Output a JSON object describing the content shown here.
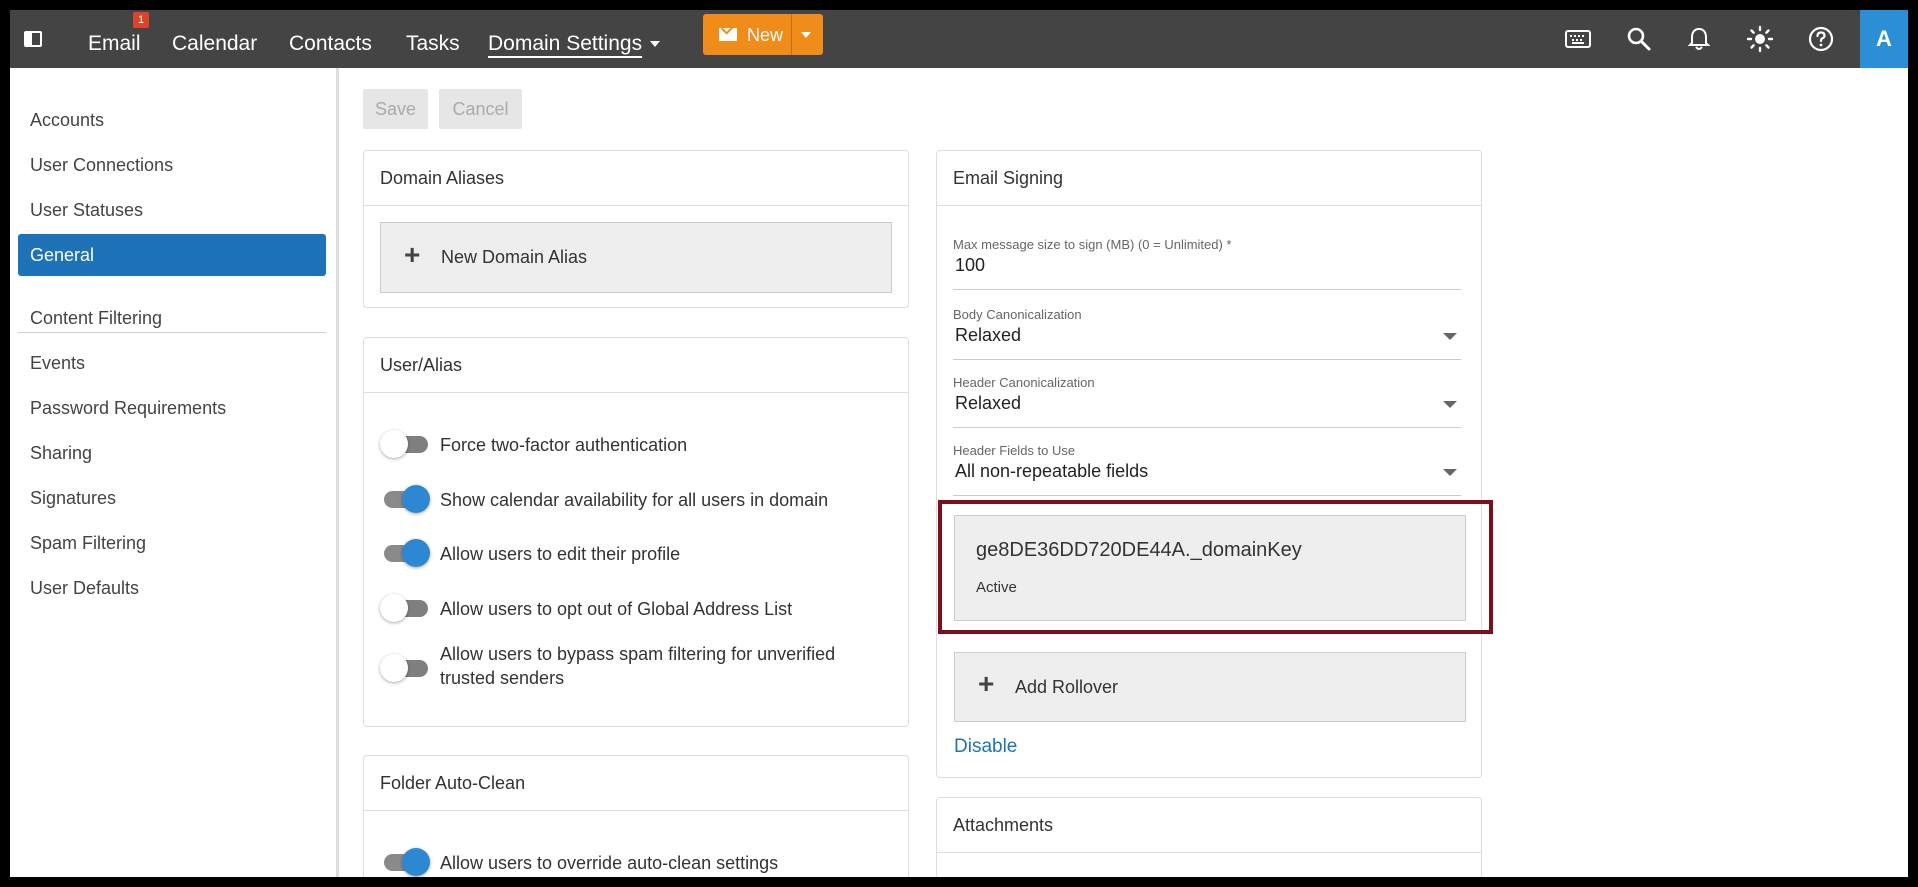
{
  "topbar": {
    "nav": [
      {
        "label": "Email",
        "badge": "1"
      },
      {
        "label": "Calendar"
      },
      {
        "label": "Contacts"
      },
      {
        "label": "Tasks"
      },
      {
        "label": "Domain Settings",
        "active": true
      }
    ],
    "new_label": "New",
    "avatar_letter": "A",
    "icons": [
      "keyboard-icon",
      "search-icon",
      "bell-icon",
      "sun-icon",
      "help-icon"
    ],
    "colors": {
      "bar": "#444444",
      "accent_orange": "#f08c1a",
      "avatar_blue": "#2b8fd6"
    }
  },
  "sidebar": {
    "group1": [
      "Accounts",
      "User Connections",
      "User Statuses",
      "General"
    ],
    "selected": "General",
    "group2": [
      "Content Filtering",
      "Events",
      "Password Requirements",
      "Sharing",
      "Signatures",
      "Spam Filtering",
      "User Defaults"
    ],
    "selected_color": "#1e73b8"
  },
  "toolbar": {
    "save_label": "Save",
    "cancel_label": "Cancel"
  },
  "domain_aliases": {
    "title": "Domain Aliases",
    "add_label": "New Domain Alias"
  },
  "user_alias": {
    "title": "User/Alias",
    "toggles": [
      {
        "label": "Force two-factor authentication",
        "on": false
      },
      {
        "label": "Show calendar availability for all users in domain",
        "on": true
      },
      {
        "label": "Allow users to edit their profile",
        "on": true
      },
      {
        "label": "Allow users to opt out of Global Address List",
        "on": false
      },
      {
        "label": "Allow users to bypass spam filtering for unverified",
        "label2": "trusted senders",
        "on": false
      }
    ]
  },
  "folder_auto_clean": {
    "title": "Folder Auto-Clean",
    "toggles": [
      {
        "label": "Allow users to override auto-clean settings",
        "on": true
      }
    ]
  },
  "email_signing": {
    "title": "Email Signing",
    "max_size": {
      "label": "Max message size to sign (MB) (0 = Unlimited)",
      "required_mark": "*",
      "value": "100"
    },
    "body_canon": {
      "label": "Body Canonicalization",
      "value": "Relaxed"
    },
    "header_canon": {
      "label": "Header Canonicalization",
      "value": "Relaxed"
    },
    "header_fields": {
      "label": "Header Fields to Use",
      "value": "All non-repeatable fields"
    },
    "key": {
      "name": "ge8DE36DD720DE44A._domainKey",
      "status": "Active"
    },
    "add_rollover_label": "Add Rollover",
    "disable_label": "Disable"
  },
  "attachments": {
    "title": "Attachments"
  }
}
